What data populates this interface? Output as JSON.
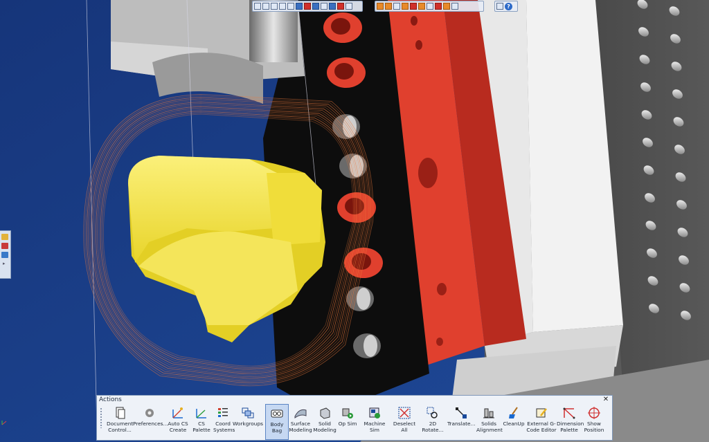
{
  "actions_panel": {
    "title": "Actions",
    "close_glyph": "✕",
    "buttons": [
      {
        "label": "Document\nControl...",
        "icon": "document-icon"
      },
      {
        "label": "Preferences...",
        "icon": "gear-icon"
      },
      {
        "label": "Auto CS\nCreate",
        "icon": "auto-cs-icon"
      },
      {
        "label": "CS Palette",
        "icon": "cs-palette-icon"
      },
      {
        "label": "Coord\nSystems",
        "icon": "coord-systems-icon"
      },
      {
        "label": "Workgroups",
        "icon": "workgroups-icon"
      },
      {
        "label": "Body Bag",
        "icon": "body-bag-icon",
        "selected": true
      },
      {
        "label": "Surface\nModeling",
        "icon": "surface-modeling-icon"
      },
      {
        "label": "Solid\nModeling",
        "icon": "solid-modeling-icon"
      },
      {
        "label": "Op Sim",
        "icon": "op-sim-icon"
      },
      {
        "label": "Machine Sim",
        "icon": "machine-sim-icon"
      },
      {
        "label": "Deselect All",
        "icon": "deselect-all-icon"
      },
      {
        "label": "2D Rotate...",
        "icon": "rotate-2d-icon"
      },
      {
        "label": "Translate...",
        "icon": "translate-icon"
      },
      {
        "label": "Solids\nAlignment",
        "icon": "solids-alignment-icon"
      },
      {
        "label": "CleanUp",
        "icon": "cleanup-icon"
      },
      {
        "label": "External G-\nCode Editor",
        "icon": "gcode-editor-icon"
      },
      {
        "label": "Dimension\nPalette",
        "icon": "dimension-palette-icon"
      },
      {
        "label": "Show\nPosition",
        "icon": "show-position-icon"
      }
    ]
  },
  "top_toolbar": {
    "help_glyph": "?"
  },
  "colors": {
    "background_blue": "#1a3a7a",
    "part_yellow": "#f2e23a",
    "toolpath_orange": "#e86a2a",
    "fixture_red": "#e0402e",
    "fixture_black": "#0c0c0c",
    "machine_gray": "#6a6a6a",
    "selected_button": "#c6d8f2"
  }
}
